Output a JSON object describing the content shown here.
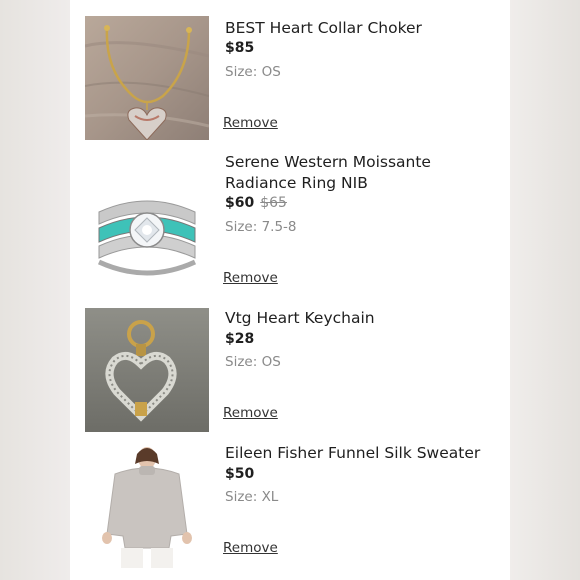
{
  "items": [
    {
      "title": "BEST Heart Collar Choker",
      "price": "$85",
      "original_price": "",
      "size_label": "Size:",
      "size_value": "OS",
      "remove_label": "Remove",
      "image": "heart-collar-choker-photo"
    },
    {
      "title": "Serene Western Moissante Radiance Ring NIB",
      "price": "$60",
      "original_price": "$65",
      "size_label": "Size:",
      "size_value": "7.5-8",
      "remove_label": "Remove",
      "image": "turquoise-ring-photo"
    },
    {
      "title": "Vtg Heart Keychain",
      "price": "$28",
      "original_price": "",
      "size_label": "Size:",
      "size_value": "OS",
      "remove_label": "Remove",
      "image": "heart-keychain-photo"
    },
    {
      "title": "Eileen Fisher Funnel Silk Sweater",
      "price": "$50",
      "original_price": "",
      "size_label": "Size:",
      "size_value": "XL",
      "remove_label": "Remove",
      "image": "sweater-model-photo"
    }
  ],
  "colors": {
    "panel_bg": "#ffffff",
    "side_bg": "#ece9e6",
    "strike_price": "#8a8a8a",
    "size_text": "#8a8a8a"
  }
}
